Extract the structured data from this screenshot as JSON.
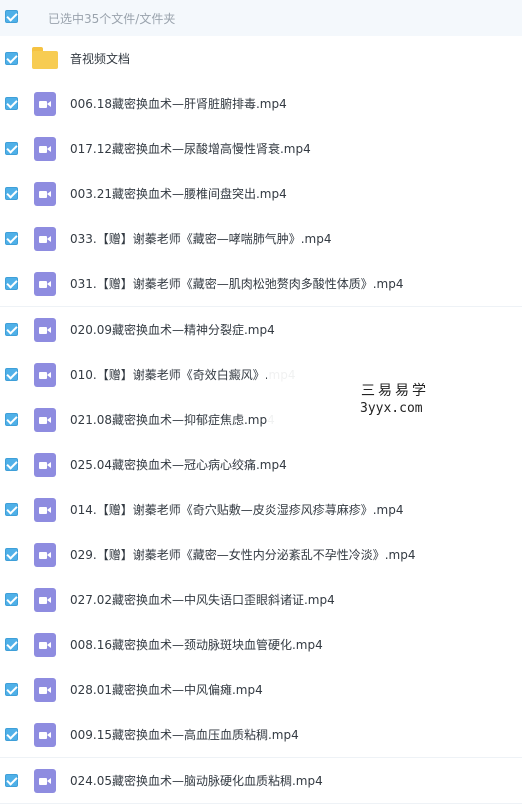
{
  "header": {
    "selection_label": "已选中35个文件/文件夹"
  },
  "folder": {
    "name": "音视频文档"
  },
  "files": [
    "006.18藏密换血术—肝肾脏腑排毒.mp4",
    "017.12藏密换血术—尿酸增高慢性肾衰.mp4",
    "003.21藏密换血术—腰椎间盘突出.mp4",
    "033.【赠】谢蓁老师《藏密—哮喘肺气肿》.mp4",
    "031.【赠】谢蓁老师《藏密—肌肉松弛赘肉多酸性体质》.mp4",
    "020.09藏密换血术—精神分裂症.mp4",
    "010.【赠】谢蓁老师《奇效白癜风》.mp4",
    "021.08藏密换血术—抑郁症焦虑.mp4",
    "025.04藏密换血术—冠心病心绞痛.mp4",
    "014.【赠】谢蓁老师《奇穴贴敷—皮炎湿疹风疹荨麻疹》.mp4",
    "029.【赠】谢蓁老师《藏密—女性内分泌紊乱不孕性冷淡》.mp4",
    "027.02藏密换血术—中风失语口歪眼斜诸证.mp4",
    "008.16藏密换血术—颈动脉斑块血管硬化.mp4",
    "028.01藏密换血术—中风偏瘫.mp4",
    "009.15藏密换血术—高血压血质粘稠.mp4",
    "024.05藏密换血术—脑动脉硬化血质粘稠.mp4"
  ],
  "watermark": {
    "site_name": "三易易学",
    "site_url": "3yyx.com"
  },
  "colors": {
    "checkbox": "#4fb0e8",
    "folder": "#f7cc52",
    "video_icon": "#8e8ce0"
  }
}
